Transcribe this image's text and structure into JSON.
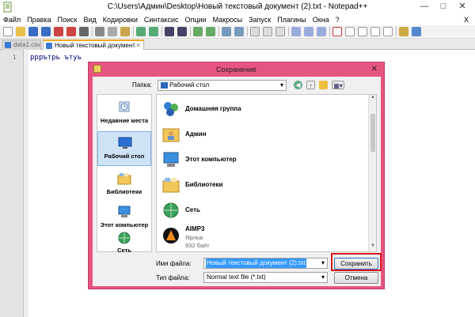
{
  "window": {
    "title": "C:\\Users\\Админ\\Desktop\\Новый текстовый документ (2).txt - Notepad++",
    "minimize": "—",
    "maximize": "□",
    "close": "✕"
  },
  "menu": {
    "items": [
      "Файл",
      "Правка",
      "Поиск",
      "Вид",
      "Кодировки",
      "Синтаксис",
      "Опции",
      "Макросы",
      "Запуск",
      "Плагины",
      "Окна",
      "?"
    ],
    "close_glyph": "X"
  },
  "tabs": [
    {
      "label": "data1.csv",
      "active": false
    },
    {
      "label": "Новый текстовый документ (2).txt",
      "active": true
    }
  ],
  "editor": {
    "line_number": "1",
    "content": "рррътрь ътуь"
  },
  "dialog": {
    "title": "Сохранение",
    "close": "✕",
    "folder_label": "Папка:",
    "folder_value": "Рабочий стол",
    "places": [
      {
        "label": "Недавние места",
        "icon": "recent-places-icon"
      },
      {
        "label": "Рабочий стол",
        "icon": "desktop-icon",
        "selected": true
      },
      {
        "label": "Библиотеки",
        "icon": "libraries-icon"
      },
      {
        "label": "Этот компьютер",
        "icon": "computer-icon"
      },
      {
        "label": "Сеть",
        "icon": "network-icon"
      }
    ],
    "files": [
      {
        "label": "Домашняя группа",
        "icon": "homegroup-icon"
      },
      {
        "label": "Админ",
        "icon": "user-folder-icon"
      },
      {
        "label": "Этот компьютер",
        "icon": "computer-icon"
      },
      {
        "label": "Библиотеки",
        "icon": "libraries-icon"
      },
      {
        "label": "Сеть",
        "icon": "network-icon"
      },
      {
        "label": "AIMP3",
        "icon": "aimp-icon",
        "sub1": "Ярлык",
        "sub2": "932 байт"
      }
    ],
    "filename_label": "Имя файла:",
    "filename_value": "Новый текстовый документ (2).txt",
    "filetype_label": "Тип файла:",
    "filetype_value": "Normal text file (*.txt)",
    "save_button": "Сохранить",
    "cancel_button": "Отмена"
  },
  "colors": {
    "dialog_frame": "#e6557f",
    "highlight": "#d7191f",
    "selection": "#3399ff"
  }
}
